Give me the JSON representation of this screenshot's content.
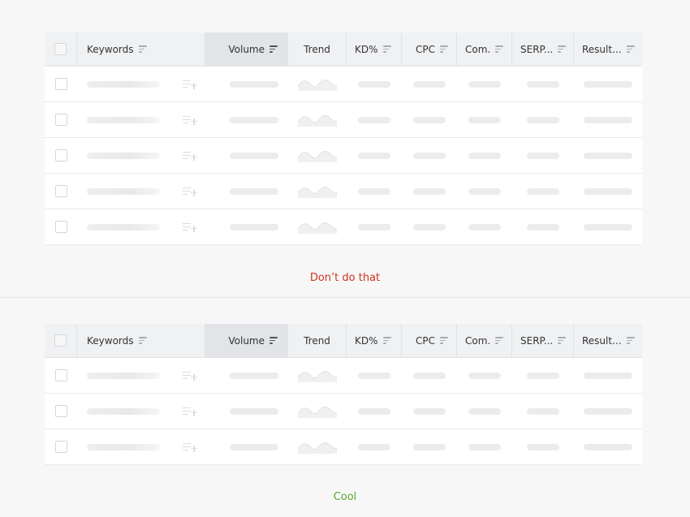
{
  "colors": {
    "bad": "#d0321d",
    "good": "#5aa52e"
  },
  "headers": {
    "keywords": "Keywords",
    "volume": "Volume",
    "trend": "Trend",
    "kd": "KD%",
    "cpc": "CPC",
    "com": "Com.",
    "serp": "SERP...",
    "results": "Result..."
  },
  "examples": [
    {
      "caption": "Don’t do that",
      "rows": 5
    },
    {
      "caption": "Cool",
      "rows": 3
    }
  ]
}
